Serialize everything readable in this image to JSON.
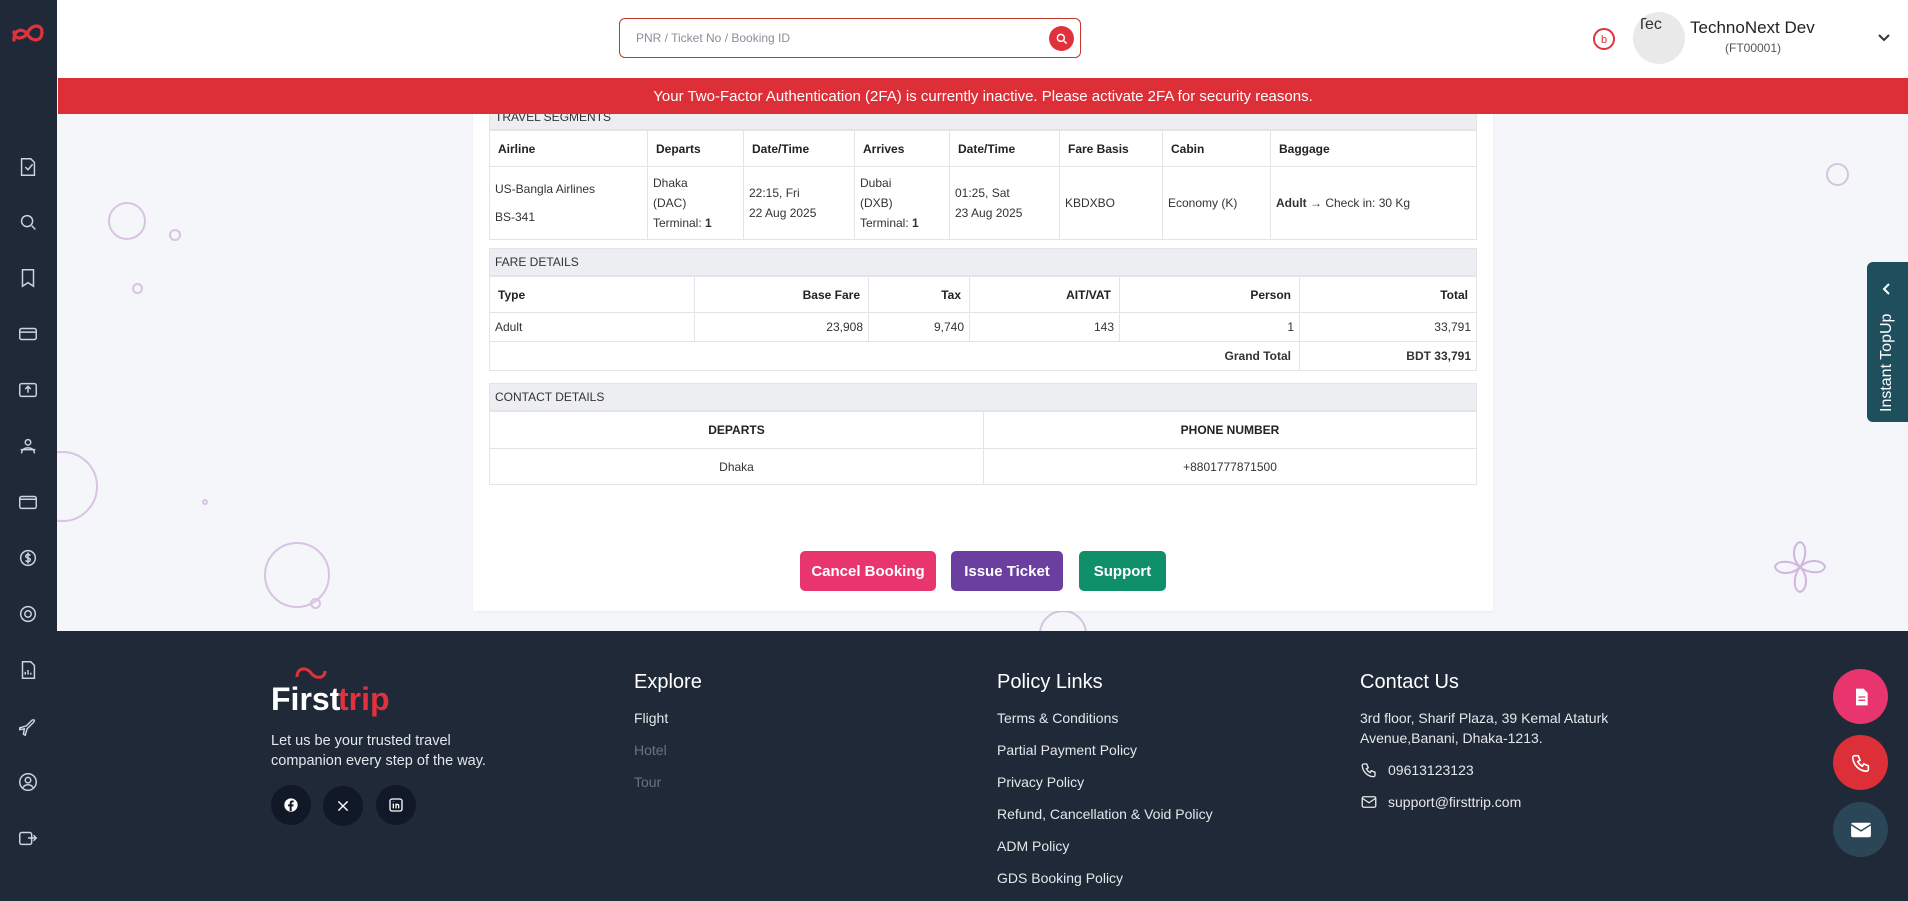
{
  "header": {
    "search_placeholder": "PNR / Ticket No / Booking ID",
    "notification_count": "2",
    "avatar_alt": "Tec",
    "user_name": "TechnoNext Dev",
    "user_id": "(FT00001)"
  },
  "alert": {
    "message": "Your Two-Factor Authentication (2FA) is currently inactive. Please activate 2FA for security reasons."
  },
  "travel_segments": {
    "title": "TRAVEL SEGMENTS",
    "headers": [
      "Airline",
      "Departs",
      "Date/Time",
      "Arrives",
      "Date/Time",
      "Fare Basis",
      "Cabin",
      "Baggage"
    ],
    "row": {
      "airline": "US-Bangla Airlines",
      "flight_no": "BS-341",
      "dep_city": "Dhaka",
      "dep_code": "(DAC)",
      "terminal_label": "Terminal:",
      "dep_terminal": "1",
      "dep_time": "22:15, Fri",
      "dep_date": "22 Aug 2025",
      "arr_city": "Dubai",
      "arr_code": "(DXB)",
      "arr_terminal": "1",
      "arr_time": "01:25, Sat",
      "arr_date": "23 Aug 2025",
      "fare_basis": "KBDXBO",
      "cabin": "Economy (K)",
      "baggage_pax": "Adult",
      "baggage_arrow": "→",
      "baggage_value": "Check in: 30 Kg"
    }
  },
  "fare_details": {
    "title": "FARE DETAILS",
    "headers": [
      "Type",
      "Base Fare",
      "Tax",
      "AIT/VAT",
      "Person",
      "Total"
    ],
    "rows": [
      [
        "Adult",
        "23,908",
        "9,740",
        "143",
        "1",
        "33,791"
      ]
    ],
    "grand_total_label": "Grand Total",
    "grand_total_value": "BDT 33,791"
  },
  "contact_details": {
    "title": "CONTACT DETAILS",
    "headers": [
      "DEPARTS",
      "PHONE NUMBER"
    ],
    "row": [
      "Dhaka",
      "+8801777871500"
    ]
  },
  "actions": {
    "cancel": "Cancel Booking",
    "issue": "Issue Ticket",
    "support": "Support"
  },
  "topup": {
    "label": "Instant TopUp"
  },
  "footer": {
    "brand_first": "First",
    "brand_trip": "trip",
    "tagline_1": "Let us be your trusted travel",
    "tagline_2": "companion every step of the way.",
    "explore": {
      "title": "Explore",
      "links": [
        "Flight",
        "Hotel",
        "Tour"
      ]
    },
    "policy": {
      "title": "Policy Links",
      "links": [
        "Terms & Conditions",
        "Partial Payment Policy",
        "Privacy Policy",
        "Refund, Cancellation & Void Policy",
        "ADM Policy",
        "GDS Booking Policy"
      ]
    },
    "contact": {
      "title": "Contact Us",
      "address_1": "3rd floor, Sharif Plaza, 39 Kemal Ataturk",
      "address_2": "Avenue,Banani, Dhaka-1213.",
      "phone": "09613123123",
      "email": "support@firsttrip.com"
    }
  },
  "colors": {
    "sidebar": "#1f2937",
    "alert": "#dc2f37",
    "cancel": "#e8356d",
    "issue": "#6b3fa0",
    "support": "#0f8f6a"
  }
}
